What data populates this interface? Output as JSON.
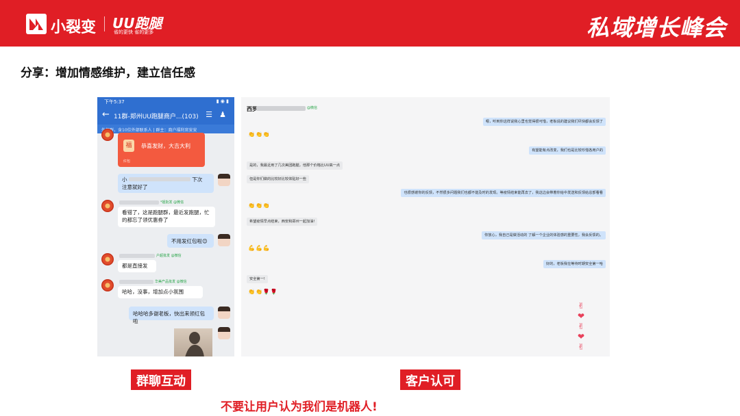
{
  "banner": {
    "brand_name": "小裂变",
    "uu_name": "UU跑腿",
    "uu_slogan": "省的更快 省的更多",
    "event_title": "私域增长峰会",
    "colors": {
      "banner": "#e01e25"
    }
  },
  "slide_title": "分享：增加情感维护，建立信任感",
  "group_chat": {
    "status_time": "下午5:37",
    "status_icons": "▮ ◉ ▮",
    "title": "11群-郑州UU跑腿商户...(103)",
    "notice": "外部群，含10位外部联系人 | 群主：商户福利官安安",
    "red_packet": {
      "text": "恭喜发财，大吉大利",
      "icon": "福",
      "label": "红包"
    },
    "messages": [
      {
        "prefix": "小",
        "suffix": "下次",
        "text": "注意就好了"
      },
      {
        "tag": "*姐批发 @微信",
        "text": "看错了，这是跑腿群，最近发跑腿，忙的都忘了领优惠券了"
      },
      {
        "text": "不用发红包啦😊"
      },
      {
        "tag": "户超批发 @微信",
        "text": "都是直接发"
      },
      {
        "tag": "华美产品批发 @微信",
        "text": "哈哈，没事，增加点小氛围"
      },
      {
        "text": "哈哈哈多谢老板，快出来领红包啦"
      }
    ]
  },
  "private_chat": {
    "contact_prefix": "西罗",
    "contact_tag": "@微信",
    "messages": [
      {
        "side": "right",
        "text": "嗯，听到你这样说我心里也觉得很可惜，老板说的建议我们尽快都会反馈了"
      },
      {
        "side": "left",
        "text": "👏👏👏"
      },
      {
        "side": "right",
        "text": "有望能有点改变，我们也是比较珍惜各用户的"
      },
      {
        "side": "left",
        "text": "是的，我最近用了几次美团跑腿，他那个价格比UU高一点"
      },
      {
        "side": "left",
        "text": "但是你们做的比较好比较体贴好一些"
      },
      {
        "side": "right",
        "text": "也很感谢你的反馈，不然很多问题我们也都不能及时的发现。等疫情结束能再去了，我这边会带着你给中发送和反馈给总部看看"
      },
      {
        "side": "left",
        "text": "👏👏👏"
      },
      {
        "side": "left",
        "text": "希望疫情早点结束，西安和郑州一起加油!"
      },
      {
        "side": "right",
        "text": "你放心，我自己是做活动的 了解一个企业的体验感的重要性，我会反馈的。"
      },
      {
        "side": "left",
        "text": "💪💪💪"
      },
      {
        "side": "right",
        "text": "好的，老板我在等待时期安全第一哈"
      },
      {
        "side": "left",
        "text": "安全第一!"
      },
      {
        "side": "left",
        "text": "👏👏🌹🌹"
      }
    ],
    "emoji_column": "✌ ❤ ✌ ❤ ✌"
  },
  "labels": {
    "group": "群聊互动",
    "private": "客户认可"
  },
  "footer_note": "不要让用户认为我们是机器人!"
}
